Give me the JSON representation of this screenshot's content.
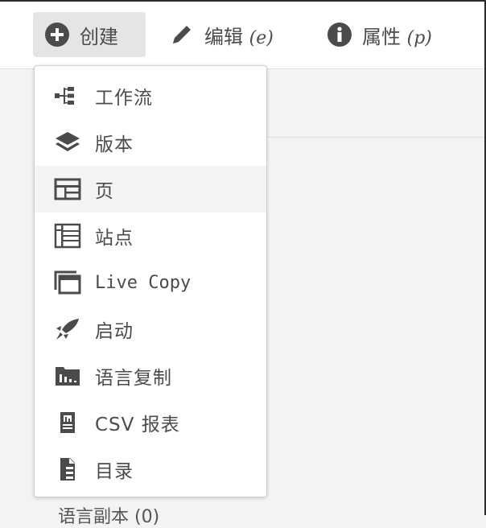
{
  "toolbar": {
    "create": {
      "label": "创建"
    },
    "edit": {
      "label": "编辑",
      "shortcut": "(e)"
    },
    "properties": {
      "label": "属性",
      "shortcut": "(p)"
    }
  },
  "menu": {
    "items": [
      {
        "label": "工作流",
        "icon": "workflow-icon"
      },
      {
        "label": "版本",
        "icon": "layers-icon"
      },
      {
        "label": "页",
        "icon": "page-icon",
        "hovered": true
      },
      {
        "label": "站点",
        "icon": "site-icon"
      },
      {
        "label": "Live Copy",
        "icon": "live-copy-icon"
      },
      {
        "label": "启动",
        "icon": "launch-icon"
      },
      {
        "label": "语言复制",
        "icon": "language-copy-icon"
      },
      {
        "label": "CSV 报表",
        "icon": "csv-report-icon"
      },
      {
        "label": "目录",
        "icon": "catalog-icon"
      }
    ]
  },
  "background": {
    "cut_text": "语言副本 (0)"
  },
  "colors": {
    "icon": "#4b4b4b",
    "text": "#4b4b4b",
    "hover": "#f4f4f4",
    "active_button": "#e5e5e5"
  }
}
